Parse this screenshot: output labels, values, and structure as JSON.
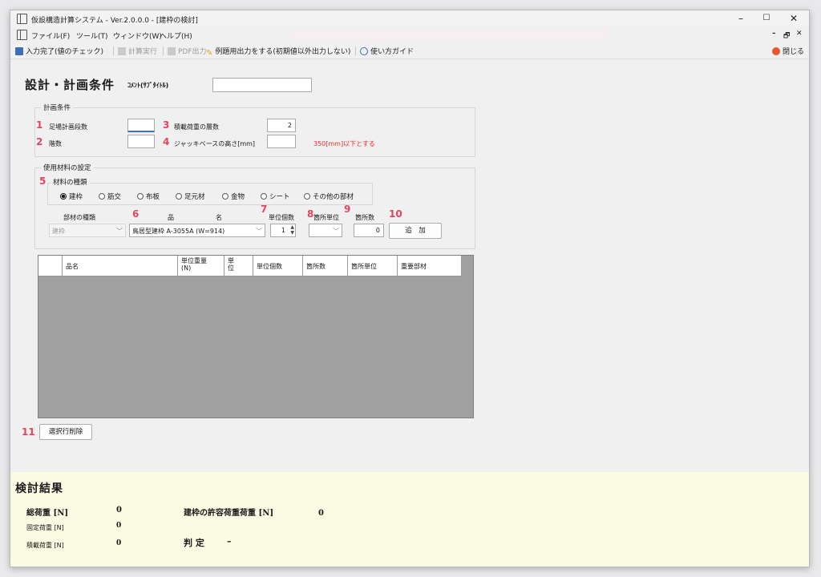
{
  "window": {
    "title": "仮設構造計算システム - Ver.2.0.0.0 - [建枠の検討]",
    "controls": {
      "minimize": "–",
      "maximize": "☐",
      "close": "✕"
    },
    "mdi_controls": {
      "minimize": "–",
      "restore": "🗗",
      "close": "✕"
    }
  },
  "menu": {
    "items": [
      "ファイル(F)",
      "ツール(T)",
      "ウィンドウ(W)",
      "ヘルプ(H)"
    ]
  },
  "toolbar": {
    "input_complete": "入力完了(値のチェック)",
    "calc": "計算実行",
    "pdf": "PDF出力",
    "example_output": "例題用出力をする(初期値以外出力しない)",
    "howto": "使い方ガイド",
    "close": "閉じる"
  },
  "page": {
    "heading": "設計・計画条件",
    "comment_label": "ｺﾒﾝﾄ(ｻﾌﾞﾀｲﾄﾙ)",
    "comment_value": ""
  },
  "plan": {
    "legend": "計画条件",
    "scaffold_stages_label": "足場計画段数",
    "scaffold_stages_value": "",
    "floors_label": "階数",
    "floors_value": "",
    "load_floors_label": "積載荷重の層数",
    "load_floors_value": "2",
    "jack_height_label": "ジャッキベースの高さ[mm]",
    "jack_height_value": "",
    "jack_note": "350[mm]以下とする"
  },
  "materials": {
    "legend": "使用材料の設定",
    "type_legend": "材料の種類",
    "options": [
      "建枠",
      "筋交",
      "布板",
      "足元材",
      "金物",
      "シート",
      "その他の部材"
    ],
    "selected": "建枠",
    "member_type_label": "部材の種類",
    "member_type_value": "建枠",
    "product_label_1": "品",
    "product_label_2": "名",
    "product_value": "鳥居型建枠  A-3055A (W=914)",
    "unit_count_label": "単位個数",
    "unit_count_value": "1",
    "place_unit_label": "箇所単位",
    "place_unit_value": "",
    "place_count_label": "箇所数",
    "place_count_value": "0",
    "add_button": "追　加"
  },
  "table": {
    "columns": [
      "",
      "品名",
      "単位重量\n(N)",
      "単\n位",
      "単位個数",
      "箇所数",
      "箇所単位",
      "重要部材"
    ],
    "rows": []
  },
  "delete_button": "選択行削除",
  "markers": [
    "1",
    "2",
    "3",
    "4",
    "5",
    "6",
    "7",
    "8",
    "9",
    "10",
    "11"
  ],
  "results": {
    "heading": "検討結果",
    "total_load_label": "総荷重 [N]",
    "total_load_value": "0",
    "fixed_load_label": "固定荷重 [N]",
    "fixed_load_value": "0",
    "live_load_label": "積載荷重 [N]",
    "live_load_value": "0",
    "allowable_label": "建枠の許容荷重荷重 [N]",
    "allowable_value": "0",
    "judge_label": "判 定",
    "judge_value": "–"
  },
  "colors": {
    "marker": "#e2455e",
    "note": "#e03030",
    "result_bg": "#fbfbe4",
    "grid_bg": "#a0a0a0"
  }
}
